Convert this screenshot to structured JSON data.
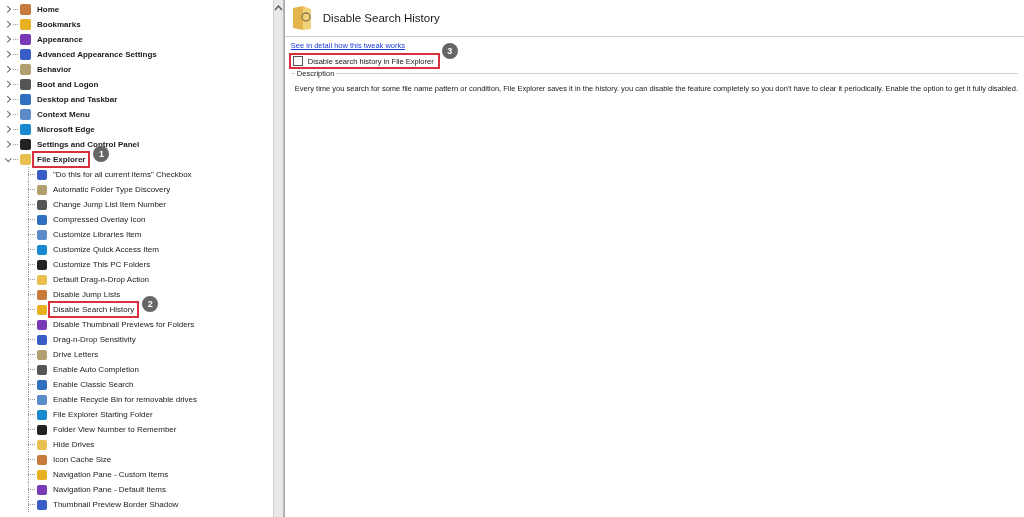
{
  "tree": [
    {
      "label": "Home",
      "expanded": false
    },
    {
      "label": "Bookmarks",
      "expanded": false
    },
    {
      "label": "Appearance",
      "expanded": false
    },
    {
      "label": "Advanced Appearance Settings",
      "expanded": false
    },
    {
      "label": "Behavior",
      "expanded": false
    },
    {
      "label": "Boot and Logon",
      "expanded": false
    },
    {
      "label": "Desktop and Taskbar",
      "expanded": false
    },
    {
      "label": "Context Menu",
      "expanded": false
    },
    {
      "label": "Microsoft Edge",
      "expanded": false
    },
    {
      "label": "Settings and Control Panel",
      "expanded": false
    },
    {
      "label": "File Explorer",
      "expanded": true,
      "callout": "1",
      "children": [
        {
          "label": "\"Do this for all current items\" Checkbox"
        },
        {
          "label": "Automatic Folder Type Discovery"
        },
        {
          "label": "Change Jump List Item Number"
        },
        {
          "label": "Compressed Overlay Icon"
        },
        {
          "label": "Customize Libraries Item"
        },
        {
          "label": "Customize Quick Access Item"
        },
        {
          "label": "Customize This PC Folders"
        },
        {
          "label": "Default Drag-n-Drop Action"
        },
        {
          "label": "Disable Jump Lists"
        },
        {
          "label": "Disable Search History",
          "callout": "2"
        },
        {
          "label": "Disable Thumbnail Previews for Folders"
        },
        {
          "label": "Drag-n-Drop Sensitivity"
        },
        {
          "label": "Drive Letters"
        },
        {
          "label": "Enable Auto Completion"
        },
        {
          "label": "Enable Classic Search"
        },
        {
          "label": "Enable Recycle Bin for removable drives"
        },
        {
          "label": "File Explorer Starting Folder"
        },
        {
          "label": "Folder View Number to Remember"
        },
        {
          "label": "Hide Drives"
        },
        {
          "label": "Icon Cache Size"
        },
        {
          "label": "Navigation Pane - Custom Items"
        },
        {
          "label": "Navigation Pane - Default Items"
        },
        {
          "label": "Thumbnail Preview Border Shadow"
        }
      ]
    }
  ],
  "panel": {
    "title": "Disable Search History",
    "link": "See in detail how this tweak works",
    "option": {
      "label": "Disable search history in File Explorer",
      "checked": false,
      "callout": "3"
    },
    "description": {
      "heading": "Description",
      "text": "Every time you search for some file name pattern or condition, File Explorer saves it in the history. you can disable the feature completely so you don't have to clear it periodically. Enable the option to get it fully disabled."
    }
  }
}
